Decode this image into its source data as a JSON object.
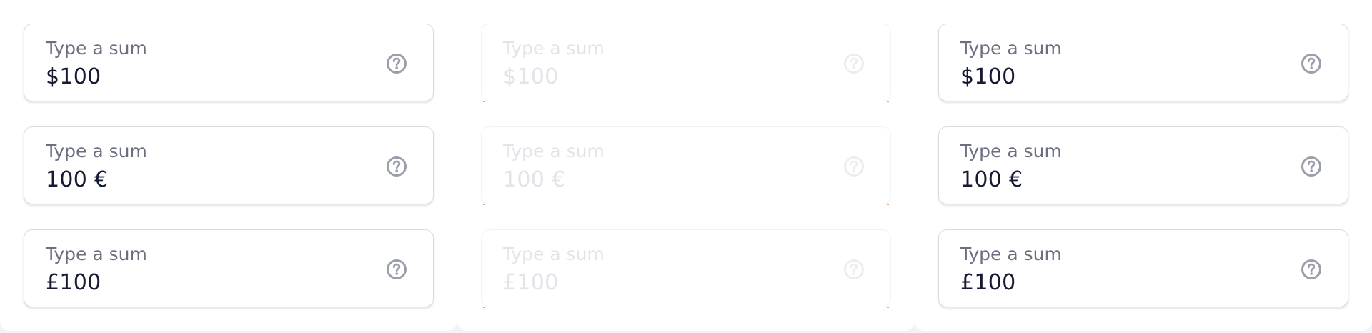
{
  "columns": [
    {
      "state": "enabled",
      "fields": [
        {
          "label": "Type a sum",
          "value": "$100",
          "icon": "help-circle-icon"
        },
        {
          "label": "Type a sum",
          "value": "100 €",
          "icon": "help-circle-icon"
        },
        {
          "label": "Type a sum",
          "value": "£100",
          "icon": "help-circle-icon"
        }
      ]
    },
    {
      "state": "disabled",
      "fields": [
        {
          "label": "Type a sum",
          "value": "$100",
          "icon": "help-circle-icon"
        },
        {
          "label": "Type a sum",
          "value": "100 €",
          "icon": "help-circle-icon"
        },
        {
          "label": "Type a sum",
          "value": "£100",
          "icon": "help-circle-icon"
        }
      ]
    },
    {
      "state": "enabled",
      "fields": [
        {
          "label": "Type a sum",
          "value": "$100",
          "icon": "help-circle-icon"
        },
        {
          "label": "Type a sum",
          "value": "100 €",
          "icon": "help-circle-icon"
        },
        {
          "label": "Type a sum",
          "value": "£100",
          "icon": "help-circle-icon"
        }
      ]
    }
  ],
  "colors": {
    "background": "#f3f3f6",
    "panel": "#ffffff",
    "border": "#d9dbe3",
    "label": "#6b6f80",
    "value": "#171a33",
    "icon": "#9b9eab",
    "disabled_text": "#e3e4ea"
  }
}
